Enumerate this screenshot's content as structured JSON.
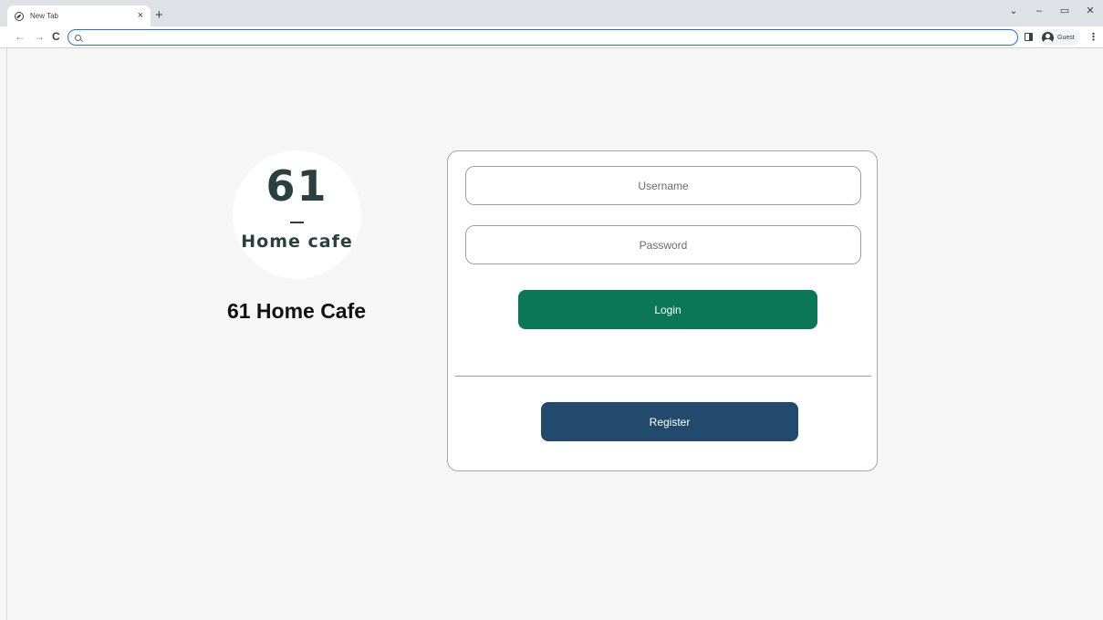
{
  "browser": {
    "tab_title": "New Tab",
    "tab_close": "×",
    "new_tab": "+",
    "window_controls": {
      "dropdown": "⌄",
      "minimize": "–",
      "restore": "▭",
      "close": "✕"
    },
    "nav": {
      "back": "←",
      "forward": "→",
      "reload": "C"
    },
    "address_value": "",
    "profile_label": "Guest",
    "menu": "⋮"
  },
  "brand": {
    "logo_number": "61",
    "logo_text": "Home cafe",
    "title": "61 Home Cafe"
  },
  "login_form": {
    "username_placeholder": "Username",
    "password_placeholder": "Password",
    "login_label": "Login",
    "register_label": "Register"
  },
  "colors": {
    "login_button": "#0b7757",
    "register_button": "#214a6c",
    "page_background": "#f6f6f6",
    "logo_ink": "#2b3f3f"
  }
}
